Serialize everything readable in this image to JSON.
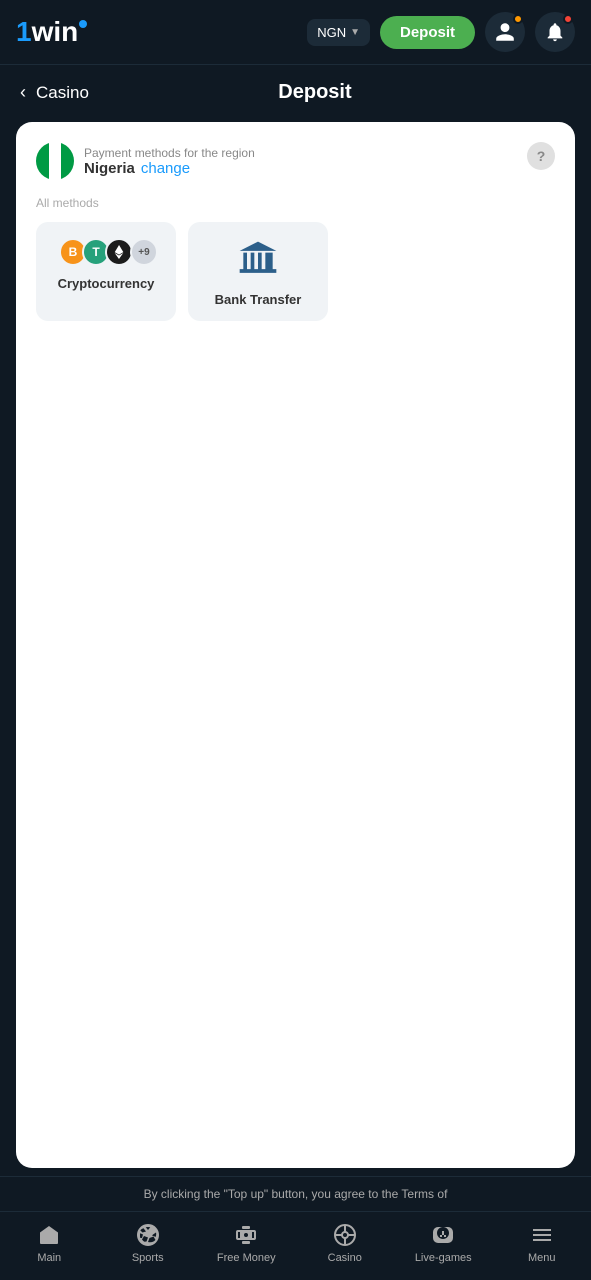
{
  "header": {
    "logo_text": "1win",
    "currency": "NGN",
    "deposit_label": "Deposit",
    "notifications_badge": "orange",
    "profile_badge": "red"
  },
  "nav": {
    "back_label": "Casino",
    "page_title": "Deposit"
  },
  "payment": {
    "region_label": "Payment methods for the region",
    "region_name": "Nigeria",
    "change_label": "change",
    "all_methods": "All methods",
    "methods": [
      {
        "id": "cryptocurrency",
        "label": "Cryptocurrency",
        "type": "crypto"
      },
      {
        "id": "bank-transfer",
        "label": "Bank Transfer",
        "type": "bank"
      }
    ],
    "crypto_icons": [
      {
        "symbol": "B",
        "class": "crypto-btc"
      },
      {
        "symbol": "T",
        "class": "crypto-usdt"
      },
      {
        "symbol": "◈",
        "class": "crypto-eth"
      },
      {
        "symbol": "+9",
        "class": "crypto-more"
      }
    ]
  },
  "terms": {
    "text": "By clicking the \"Top up\" button, you agree to the Terms of"
  },
  "bottom_nav": {
    "items": [
      {
        "id": "main",
        "label": "Main",
        "icon": "main-icon"
      },
      {
        "id": "sports",
        "label": "Sports",
        "icon": "sports-icon"
      },
      {
        "id": "free-money",
        "label": "Free Money",
        "icon": "free-money-icon"
      },
      {
        "id": "casino",
        "label": "Casino",
        "icon": "casino-icon"
      },
      {
        "id": "live-games",
        "label": "Live-games",
        "icon": "live-games-icon"
      },
      {
        "id": "menu",
        "label": "Menu",
        "icon": "menu-icon"
      }
    ]
  }
}
